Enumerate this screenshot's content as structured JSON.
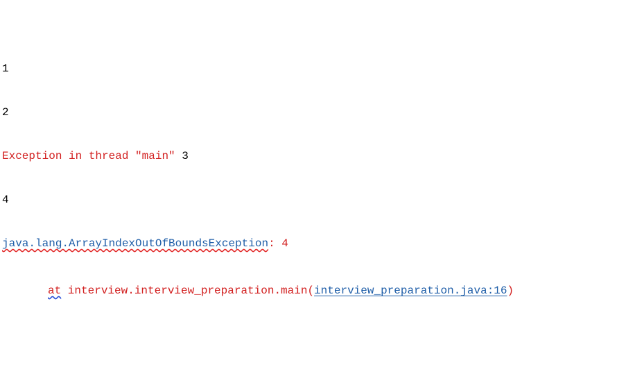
{
  "console": {
    "lines": [
      {
        "text": "1"
      },
      {
        "text": "2"
      },
      {
        "prefix": "Exception in thread \"main\" ",
        "value": "3"
      },
      {
        "text": "4"
      }
    ],
    "exception": {
      "class_name": "java.lang.ArrayIndexOutOfBoundsException",
      "separator": ":",
      "message": " 4"
    },
    "stack_trace": {
      "at": "at",
      "method": " interview.interview_preparation.main(",
      "location": "interview_preparation.java:16",
      "close": ")"
    }
  },
  "colors": {
    "error_red": "#d21f1f",
    "link_blue": "#1f5ea8",
    "squiggle_red": "#e22a2a",
    "squiggle_blue": "#2b4fd6"
  }
}
